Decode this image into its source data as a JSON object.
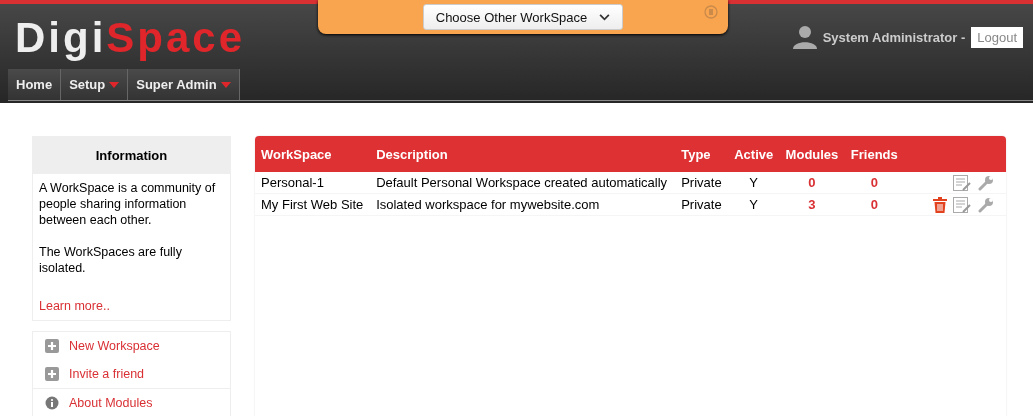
{
  "logo": {
    "prefix": "Digi",
    "suffix": "Space"
  },
  "workspace_switcher": {
    "label": "Choose Other WorkSpace"
  },
  "user": {
    "name": "System Administrator -",
    "logout": "Logout"
  },
  "nav": [
    {
      "label": "Home",
      "has_menu": false
    },
    {
      "label": "Setup",
      "has_menu": true
    },
    {
      "label": "Super Admin",
      "has_menu": true
    }
  ],
  "info_panel": {
    "title": "Information",
    "paragraphs": [
      "A WorkSpace is a community of people sharing information between each other.",
      "The WorkSpaces are fully isolated."
    ],
    "link": "Learn more.."
  },
  "actions": [
    {
      "kind": "add",
      "label": "New Workspace"
    },
    {
      "kind": "add",
      "label": "Invite a friend"
    },
    {
      "kind": "info",
      "label": "About Modules"
    }
  ],
  "table": {
    "columns": [
      "WorkSpace",
      "Description",
      "Type",
      "Active",
      "Modules",
      "Friends"
    ],
    "rows": [
      {
        "workspace": "Personal-1",
        "description": "Default Personal Workspace created automatically",
        "type": "Private",
        "active": "Y",
        "modules": "0",
        "friends": "0",
        "deletable": false
      },
      {
        "workspace": "My First Web Site",
        "description": "Isolated workspace for mywebsite.com",
        "type": "Private",
        "active": "Y",
        "modules": "3",
        "friends": "0",
        "deletable": true
      }
    ]
  }
}
